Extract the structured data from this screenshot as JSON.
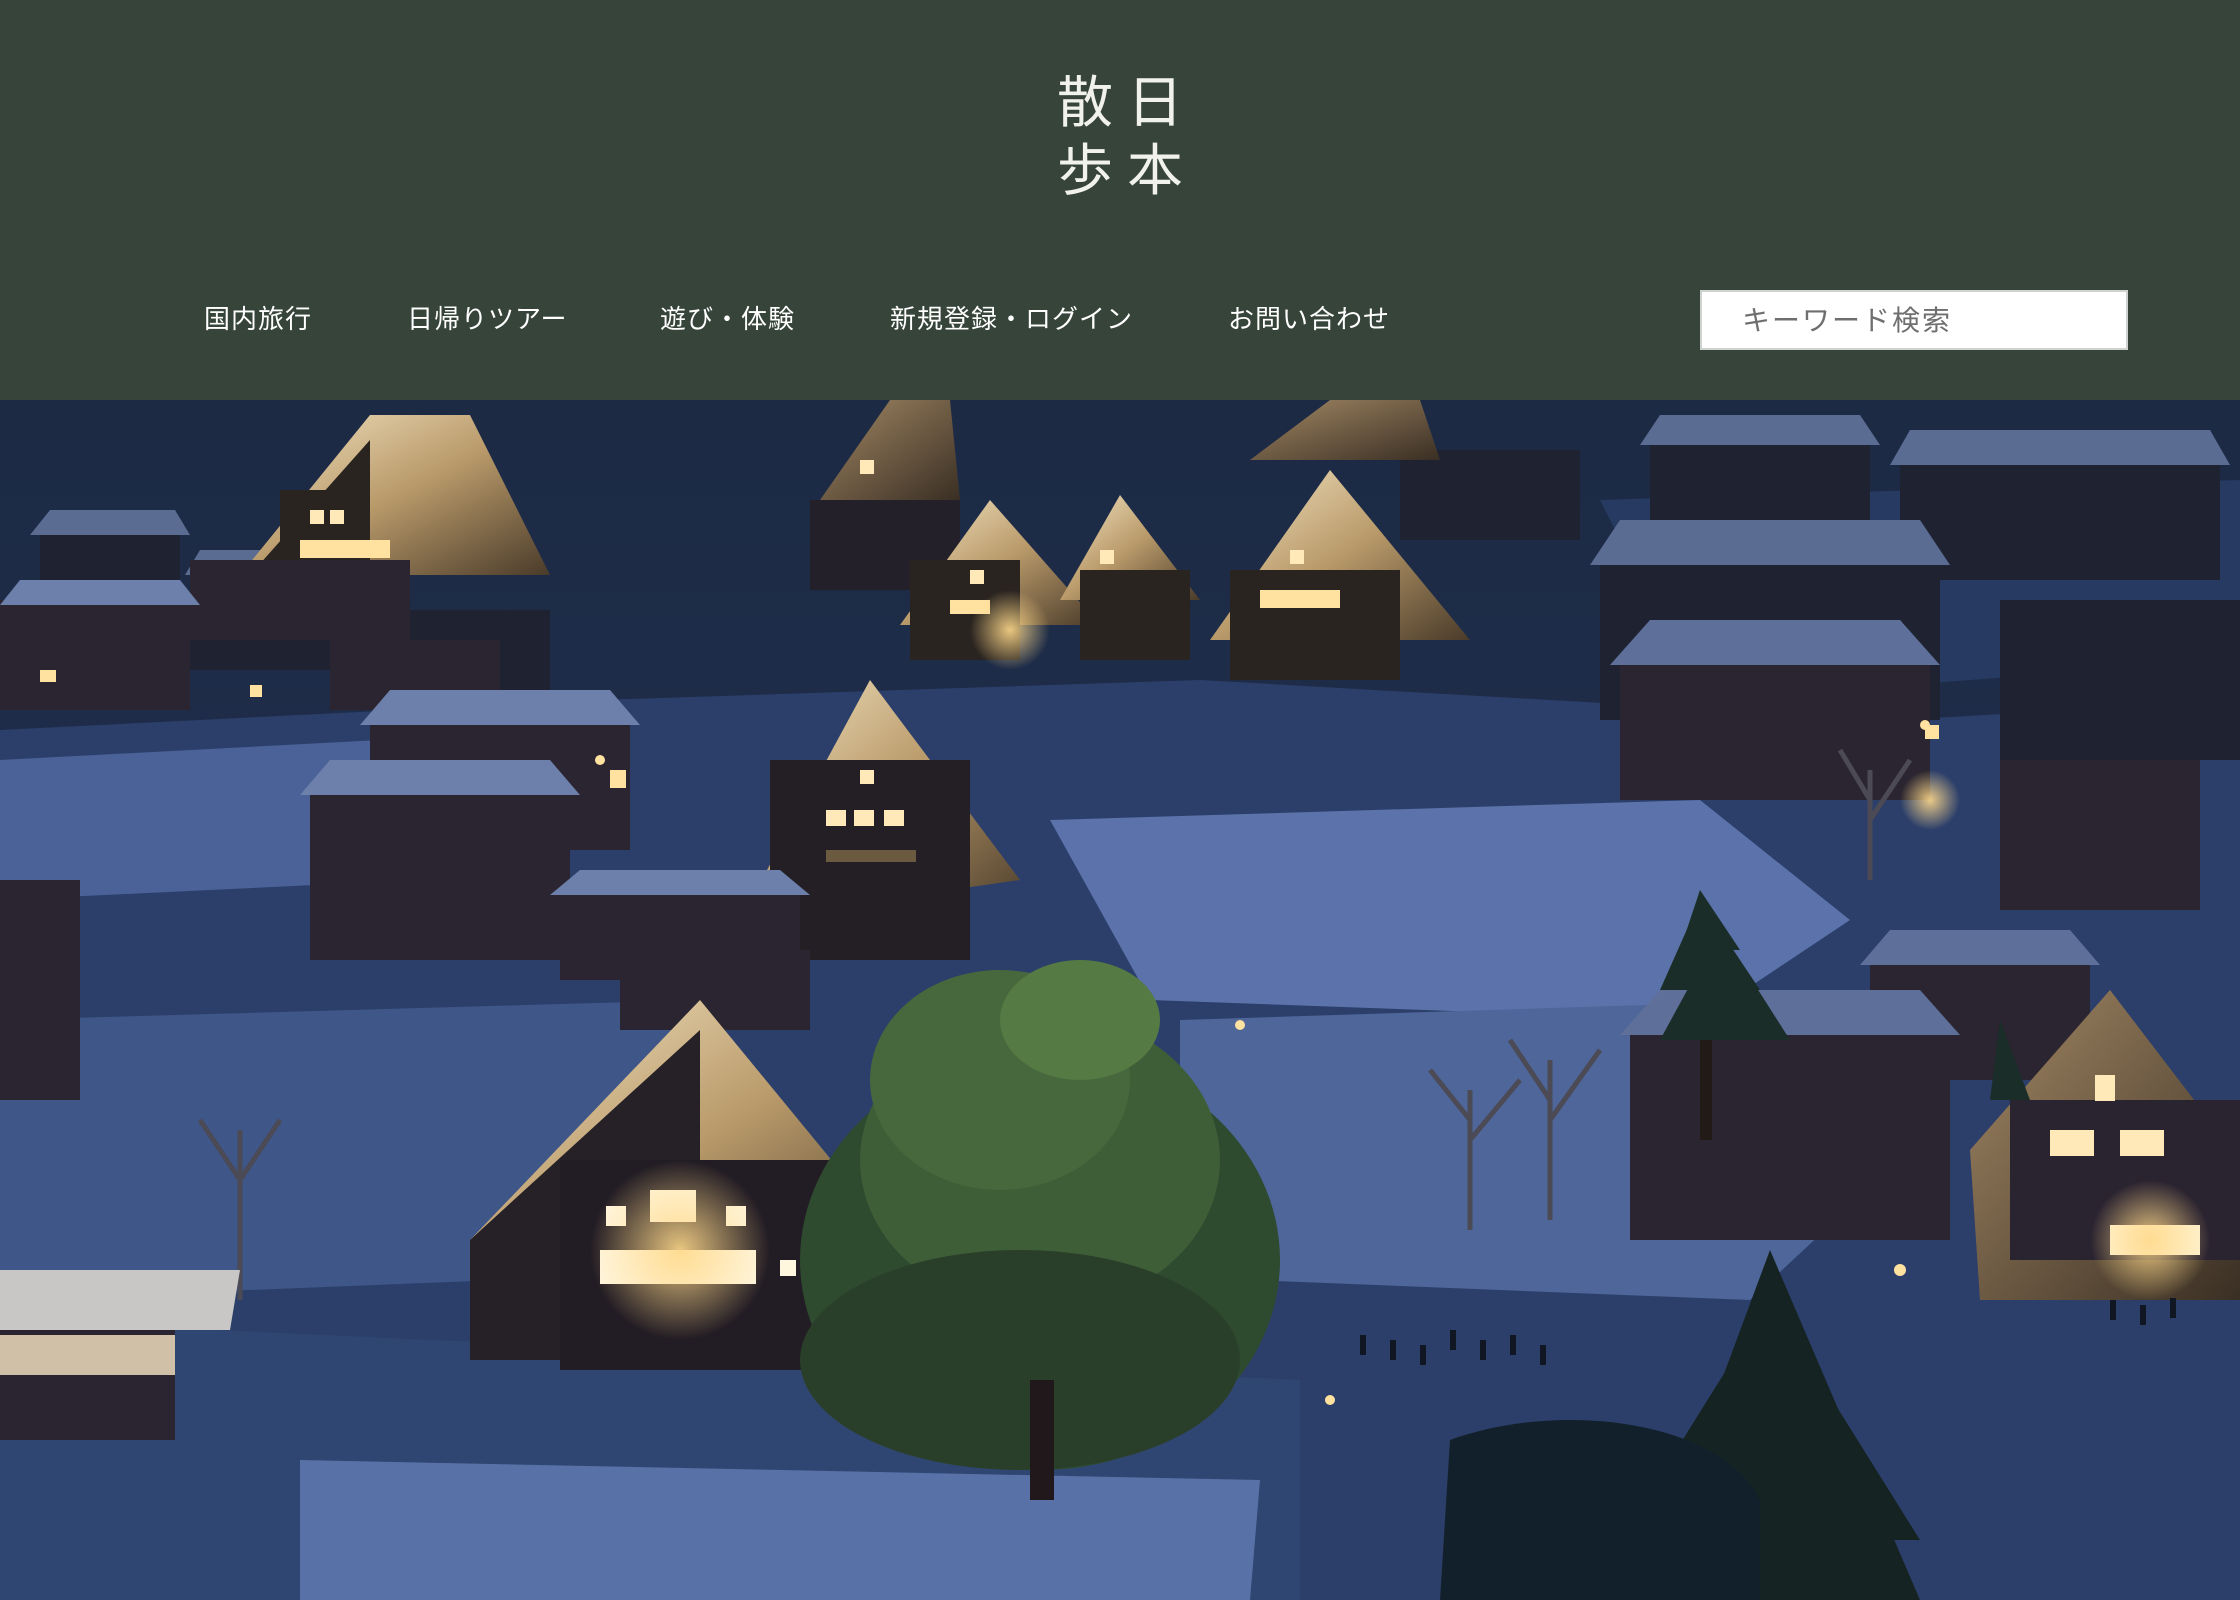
{
  "logo": {
    "chars": [
      "散",
      "日",
      "歩",
      "本"
    ]
  },
  "nav": {
    "items": [
      {
        "label": "国内旅行"
      },
      {
        "label": "日帰りツアー"
      },
      {
        "label": "遊び・体験"
      },
      {
        "label": "新規登録・ログイン"
      },
      {
        "label": "お問い合わせ"
      }
    ]
  },
  "search": {
    "placeholder": "キーワード検索"
  },
  "colors": {
    "header_bg": "#36443a",
    "nav_text": "#ffffff",
    "logo_text": "#f2f2ec"
  },
  "hero": {
    "scene": "snowy village of thatched-roof houses at night"
  }
}
